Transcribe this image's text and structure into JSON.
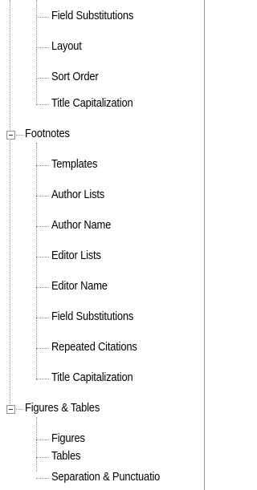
{
  "tree": {
    "top_items": [
      "Field Substitutions",
      "Layout",
      "Sort Order",
      "Title Capitalization"
    ],
    "groups": [
      {
        "label": "Footnotes",
        "expanded": true,
        "children": [
          "Templates",
          "Author Lists",
          "Author Name",
          "Editor Lists",
          "Editor Name",
          "Field Substitutions",
          "Repeated Citations",
          "Title Capitalization"
        ]
      },
      {
        "label": "Figures & Tables",
        "expanded": true,
        "children": [
          "Figures",
          "Tables",
          "Separation & Punctuatio"
        ]
      }
    ]
  }
}
